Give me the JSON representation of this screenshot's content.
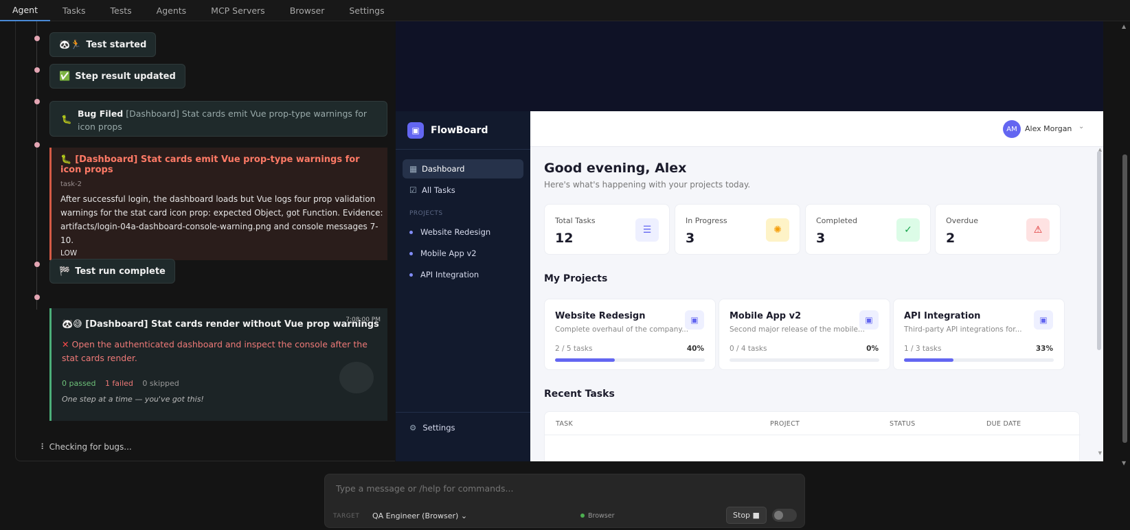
{
  "tabs": [
    "Agent",
    "Tasks",
    "Tests",
    "Agents",
    "MCP Servers",
    "Browser",
    "Settings"
  ],
  "timeline": {
    "test_started": "Test started",
    "step_updated": "Step result updated",
    "bug_filed_label": "Bug Filed",
    "bug_filed_text": "[Dashboard] Stat cards emit Vue prop-type warnings for icon props",
    "bug": {
      "title": "[Dashboard] Stat cards emit Vue prop-type warnings for icon props",
      "task": "task-2",
      "body": "After successful login, the dashboard loads but Vue logs four prop validation warnings for the stat card icon prop: expected Object, got Function. Evidence: artifacts/login-04a-dashboard-console-warning.png and console messages 7-10.",
      "severity": "LOW"
    },
    "run_complete": "Test run complete",
    "result": {
      "time": "7:08:00 PM",
      "title": "[Dashboard] Stat cards render without Vue prop warnings",
      "failure": "Open the authenticated dashboard and inspect the console after the stat cards render.",
      "passed": "0 passed",
      "failed": "1 failed",
      "skipped": "0 skipped",
      "motto": "One step at a time — you've got this!"
    },
    "status": "Checking for bugs..."
  },
  "browser": {
    "brand": "FlowBoard",
    "nav": {
      "dashboard": "Dashboard",
      "all_tasks": "All Tasks",
      "projects_label": "PROJECTS",
      "settings": "Settings"
    },
    "sidebar_projects": [
      "Website Redesign",
      "Mobile App v2",
      "API Integration"
    ],
    "user": {
      "initials": "AM",
      "name": "Alex Morgan"
    },
    "greeting": "Good evening, Alex",
    "greeting_sub": "Here's what's happening with your projects today.",
    "stats": [
      {
        "label": "Total Tasks",
        "value": "12"
      },
      {
        "label": "In Progress",
        "value": "3"
      },
      {
        "label": "Completed",
        "value": "3"
      },
      {
        "label": "Overdue",
        "value": "2"
      }
    ],
    "my_projects": "My Projects",
    "projects": [
      {
        "name": "Website Redesign",
        "desc": "Complete overhaul of the company...",
        "tasks": "2 / 5 tasks",
        "pct": "40%",
        "progress": 0.4
      },
      {
        "name": "Mobile App v2",
        "desc": "Second major release of the mobile...",
        "tasks": "0 / 4 tasks",
        "pct": "0%",
        "progress": 0
      },
      {
        "name": "API Integration",
        "desc": "Third-party API integrations for...",
        "tasks": "1 / 3 tasks",
        "pct": "33%",
        "progress": 0.33
      }
    ],
    "recent_tasks": "Recent Tasks",
    "columns": [
      "TASK",
      "PROJECT",
      "STATUS",
      "DUE DATE"
    ]
  },
  "composer": {
    "placeholder": "Type a message or /help for commands...",
    "target_label": "TARGET",
    "target_value": "QA Engineer (Browser)",
    "browser_status": "Browser",
    "stop": "Stop"
  }
}
